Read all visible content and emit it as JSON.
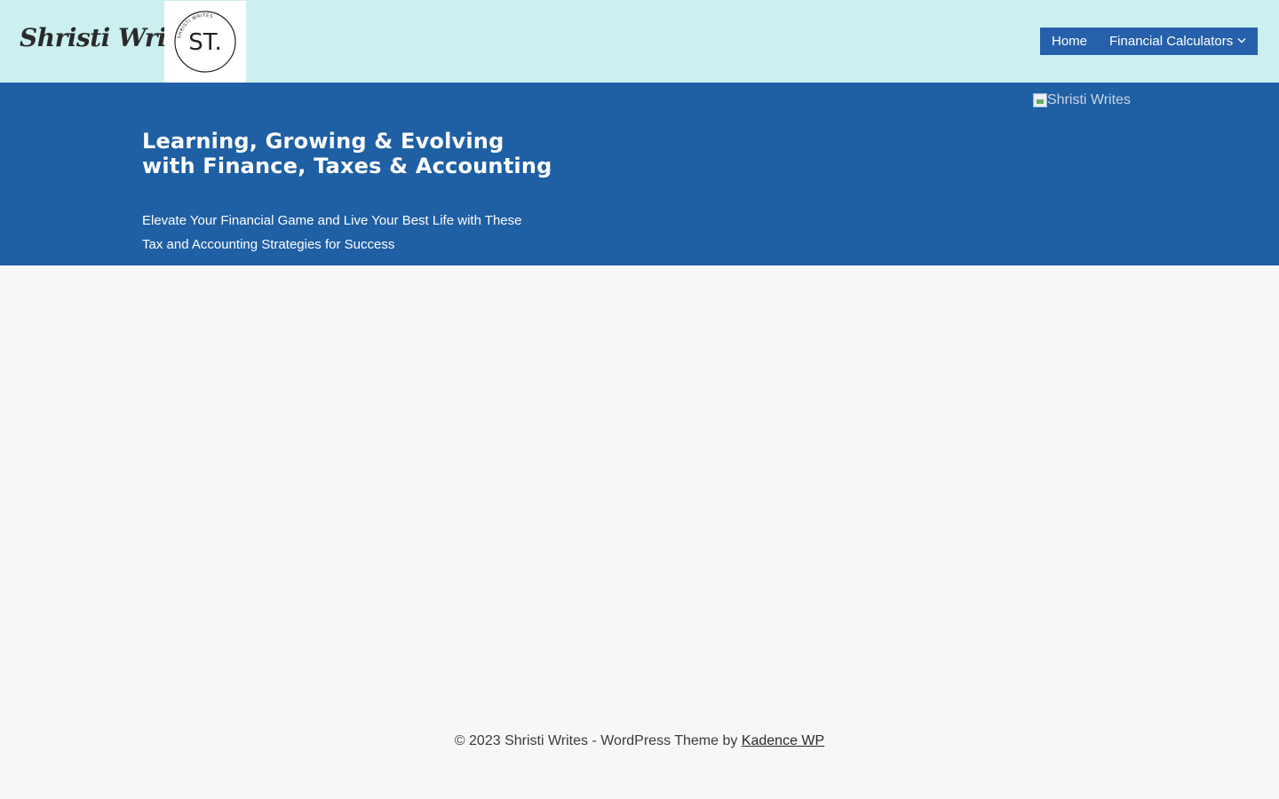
{
  "header": {
    "site_title": "Shristi Writes",
    "logo": {
      "mark": "ST.",
      "ring_text": "SHRISTI WRITES"
    },
    "nav": {
      "items": [
        {
          "label": "Home"
        },
        {
          "label": "Financial Calculators",
          "icon": "chevron-down-icon"
        }
      ]
    },
    "colors": {
      "header_bg": "#ccefef",
      "nav_bg": "#2660aa"
    }
  },
  "hero": {
    "title": "Learning, Growing & Evolving with Finance, Taxes & Accounting",
    "subtitle": "Elevate Your Financial Game and Live Your Best Life with These Tax and Accounting Strategies for Success",
    "image_alt": "Shristi Writes",
    "colors": {
      "bg": "#1f5fa4"
    }
  },
  "footer": {
    "copyright": "© 2023 Shristi Writes - WordPress Theme by",
    "link_label": "Kadence WP"
  }
}
